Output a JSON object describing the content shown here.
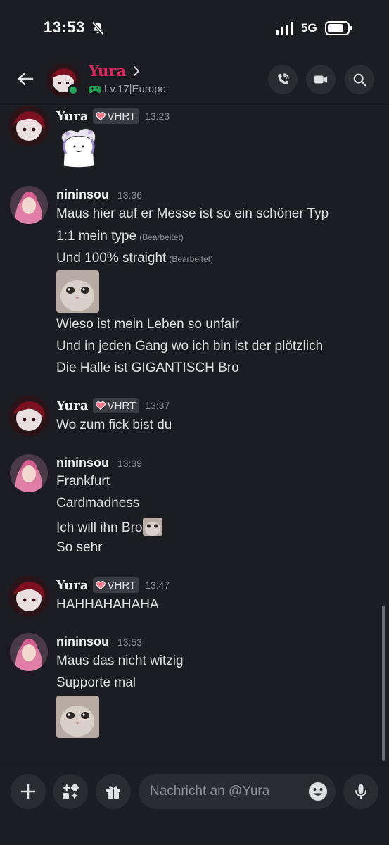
{
  "status_bar": {
    "time": "13:53",
    "network": "5G"
  },
  "header": {
    "name": "Yura",
    "subtitle": "Lv.17|Europe"
  },
  "badge_label": "VHRT",
  "messages": [
    {
      "author": "Yura",
      "time": "13:23",
      "lines": []
    },
    {
      "author": "nininsou",
      "time": "13:36",
      "lines": [
        {
          "text": "Maus hier auf er Messe ist so ein schöner Typ"
        },
        {
          "text": "1:1 mein type",
          "edited": "(Bearbeitet)"
        },
        {
          "text": "Und 100% straight",
          "edited": "(Bearbeitet)"
        },
        {
          "text": "Wieso ist mein Leben so unfair"
        },
        {
          "text": "Und in jeden Gang wo ich bin ist der plötzlich"
        },
        {
          "text": "Die Halle ist GIGANTISCH Bro"
        }
      ]
    },
    {
      "author": "Yura",
      "time": "13:37",
      "lines": [
        {
          "text": "Wo zum fick bist du"
        }
      ]
    },
    {
      "author": "nininsou",
      "time": "13:39",
      "lines": [
        {
          "text": "Frankfurt"
        },
        {
          "text": "Cardmadness"
        },
        {
          "text": "Ich will ihn Bro"
        },
        {
          "text": "So sehr"
        }
      ]
    },
    {
      "author": "Yura",
      "time": "13:47",
      "lines": [
        {
          "text": "HAHHAHAHAHA"
        }
      ]
    },
    {
      "author": "nininsou",
      "time": "13:53",
      "lines": [
        {
          "text": "Maus das nicht witzig"
        },
        {
          "text": "Supporte mal"
        }
      ]
    }
  ],
  "composer": {
    "placeholder": "Nachricht an @Yura"
  },
  "colors": {
    "background": "#1c1d22",
    "username_accent": "#e0245e",
    "online": "#23a559",
    "badge_heart": "#f47b8e"
  }
}
